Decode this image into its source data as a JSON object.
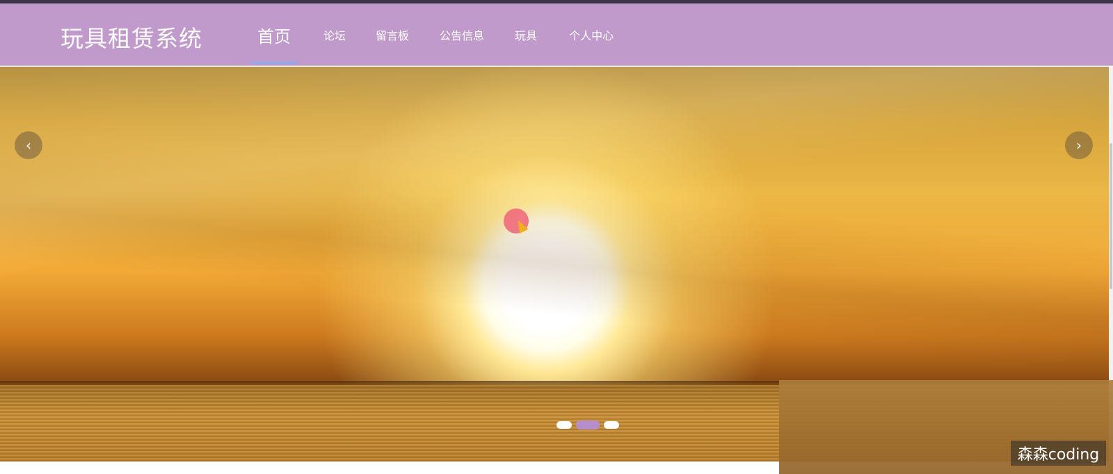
{
  "brand": {
    "title": "玩具租赁系统"
  },
  "nav": {
    "items": [
      {
        "label": "首页",
        "active": true
      },
      {
        "label": "论坛",
        "active": false
      },
      {
        "label": "留言板",
        "active": false
      },
      {
        "label": "公告信息",
        "active": false
      },
      {
        "label": "玩具",
        "active": false
      },
      {
        "label": "个人中心",
        "active": false
      }
    ]
  },
  "carousel": {
    "prev_icon": "chevron-left-icon",
    "next_icon": "chevron-right-icon",
    "prev_glyph": "‹",
    "next_glyph": "›",
    "slide_count": 3,
    "active_slide": 2,
    "image": "sunset-over-sea"
  },
  "watermark": {
    "text": "森森coding"
  },
  "colors": {
    "navbar": "#bf9acb",
    "active_underline": "#8da8ee",
    "active_dot": "#b58ecb"
  }
}
